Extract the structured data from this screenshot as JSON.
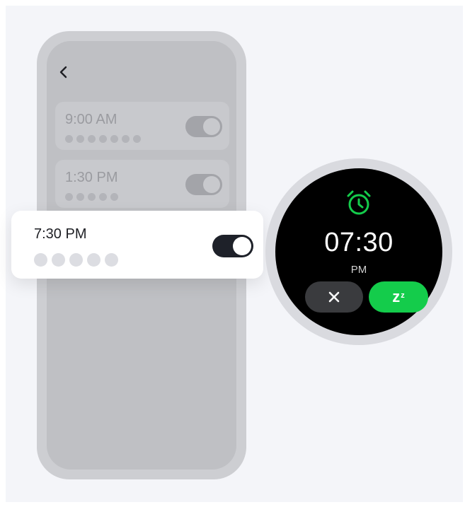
{
  "phone": {
    "alarms": [
      {
        "time": "9:00 AM",
        "days": 7
      },
      {
        "time": "1:30 PM",
        "days": 5
      }
    ]
  },
  "highlighted_alarm": {
    "time": "7:30 PM",
    "days": 5,
    "enabled": true
  },
  "watch": {
    "time": "07:30",
    "ampm": "PM",
    "snooze_label": "z",
    "snooze_sup": "z",
    "dismiss_icon": "close-icon",
    "alarm_icon": "alarm-clock-icon"
  },
  "colors": {
    "accent_green": "#14cc4b",
    "toggle_on": "#1e2129",
    "watch_bezel": "#d9dadf"
  }
}
